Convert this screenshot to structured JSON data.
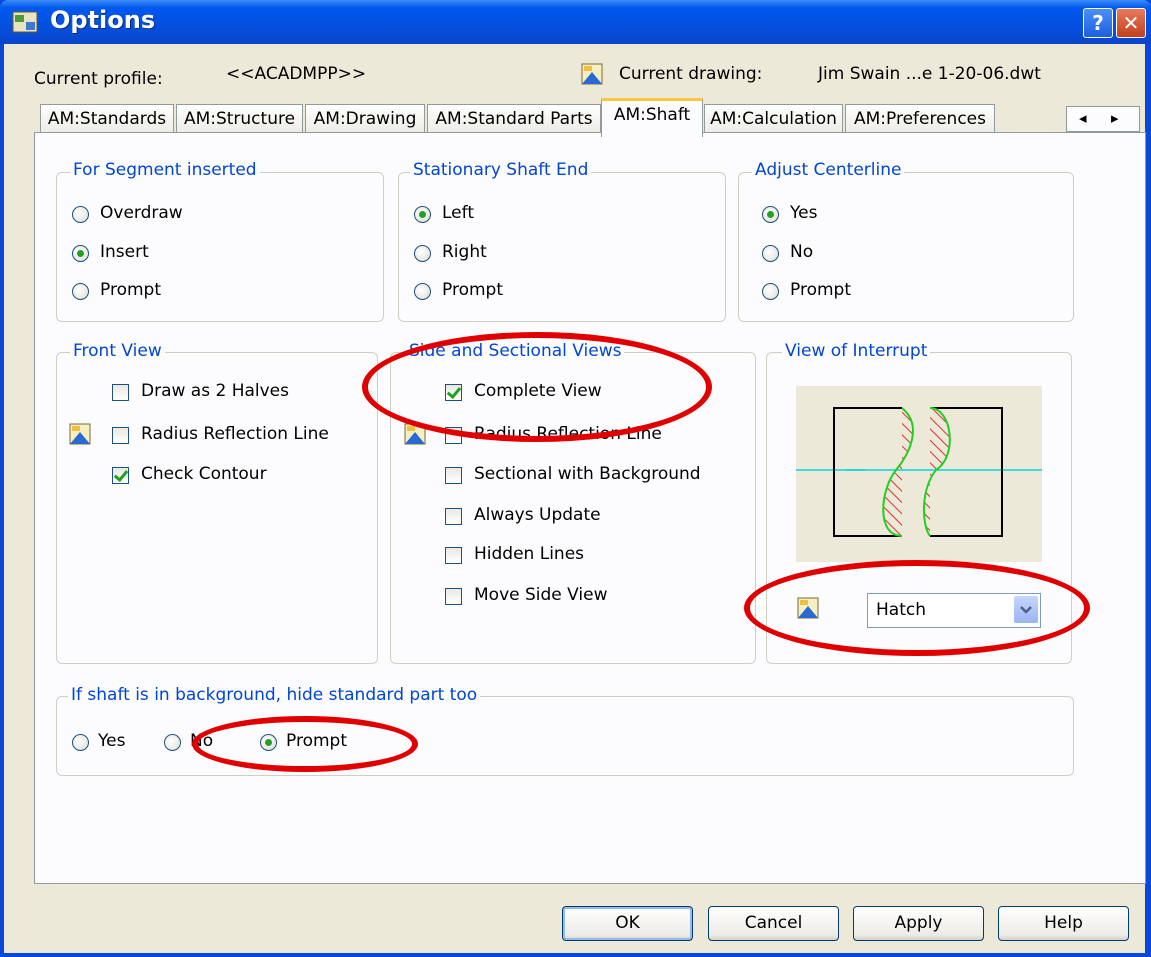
{
  "title": "Options",
  "titlebar": {
    "help_label": "?",
    "close_label": "✕"
  },
  "profile": {
    "label": "Current profile:",
    "value": "<<ACADMPP>>"
  },
  "drawing": {
    "label": "Current drawing:",
    "value": "Jim Swain ...e 1-20-06.dwt",
    "icon": "drawing-icon"
  },
  "tabs": [
    {
      "label": "AM:Standards",
      "active": false
    },
    {
      "label": "AM:Structure",
      "active": false
    },
    {
      "label": "AM:Drawing",
      "active": false
    },
    {
      "label": "AM:Standard Parts",
      "active": false
    },
    {
      "label": "AM:Shaft",
      "active": true
    },
    {
      "label": "AM:Calculation",
      "active": false
    },
    {
      "label": "AM:Preferences",
      "active": false
    }
  ],
  "tab_scroll": {
    "left": "◂",
    "right": "▸"
  },
  "segment": {
    "title": "For Segment inserted",
    "options": [
      "Overdraw",
      "Insert",
      "Prompt"
    ],
    "selected": "Insert"
  },
  "stationary": {
    "title": "Stationary Shaft End",
    "options": [
      "Left",
      "Right",
      "Prompt"
    ],
    "selected": "Left"
  },
  "centerline": {
    "title": "Adjust Centerline",
    "options": [
      "Yes",
      "No",
      "Prompt"
    ],
    "selected": "Yes"
  },
  "front_view": {
    "title": "Front View",
    "items": [
      {
        "label": "Draw as 2 Halves",
        "checked": false
      },
      {
        "label": "Radius Reflection Line",
        "checked": false
      },
      {
        "label": "Check Contour",
        "checked": true
      }
    ]
  },
  "side_views": {
    "title": "Side and Sectional Views",
    "items": [
      {
        "label": "Complete View",
        "checked": true
      },
      {
        "label": "Radius Reflection Line",
        "checked": false
      },
      {
        "label": "Sectional with Background",
        "checked": false
      },
      {
        "label": "Always Update",
        "checked": false
      },
      {
        "label": "Hidden Lines",
        "checked": false
      },
      {
        "label": "Move Side View",
        "checked": false
      }
    ]
  },
  "interrupt": {
    "title": "View of Interrupt",
    "select_value": "Hatch"
  },
  "background": {
    "title": "If shaft is in background, hide standard part too",
    "options": [
      "Yes",
      "No",
      "Prompt"
    ],
    "selected": "Prompt"
  },
  "buttons": {
    "ok": "OK",
    "cancel": "Cancel",
    "apply": "Apply",
    "help": "Help"
  },
  "colors": {
    "titlebar": "#0058ee",
    "group_title": "#0046d5",
    "highlight": "#e00000",
    "radio_dot": "#21a121"
  }
}
